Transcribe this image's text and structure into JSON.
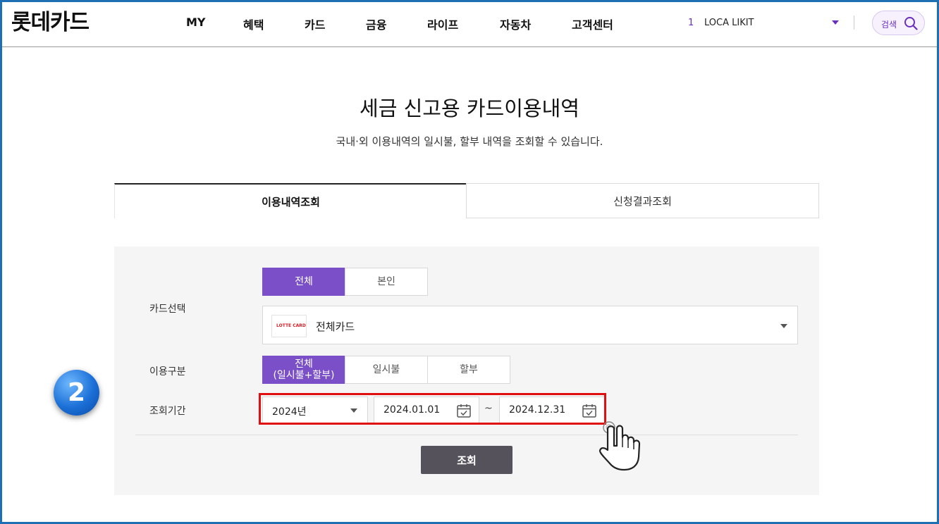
{
  "header": {
    "logo": "롯데카드",
    "nav": [
      "MY",
      "혜택",
      "카드",
      "금융",
      "라이프",
      "자동차",
      "고객센터"
    ],
    "user_count": "1",
    "user_name": "LOCA LIKIT",
    "search_label": "검색"
  },
  "page": {
    "title": "세금 신고용 카드이용내역",
    "description": "국내·외 이용내역의 일시불, 할부 내역을 조회할 수 있습니다."
  },
  "tabs": [
    {
      "label": "이용내역조회",
      "active": true
    },
    {
      "label": "신청결과조회",
      "active": false
    }
  ],
  "form": {
    "card_select_label": "카드선택",
    "owner_options": [
      {
        "label": "전체",
        "selected": true
      },
      {
        "label": "본인",
        "selected": false
      }
    ],
    "card_thumb_text": "LOTTE CARD",
    "card_value": "전체카드",
    "usage_type_label": "이용구분",
    "usage_options": [
      {
        "label_line1": "전체",
        "label_line2": "(일시불+할부)",
        "selected": true
      },
      {
        "label_line1": "일시불",
        "label_line2": "",
        "selected": false
      },
      {
        "label_line1": "할부",
        "label_line2": "",
        "selected": false
      }
    ],
    "period_label": "조회기간",
    "year_value": "2024년",
    "start_date": "2024.01.01",
    "range_separator": "~",
    "end_date": "2024.12.31",
    "submit_label": "조회"
  },
  "annotation": {
    "step_number": "2"
  },
  "colors": {
    "accent": "#7a4fc8",
    "highlight": "#e01010",
    "submit": "#55525c",
    "frame": "#1f6fb5"
  }
}
